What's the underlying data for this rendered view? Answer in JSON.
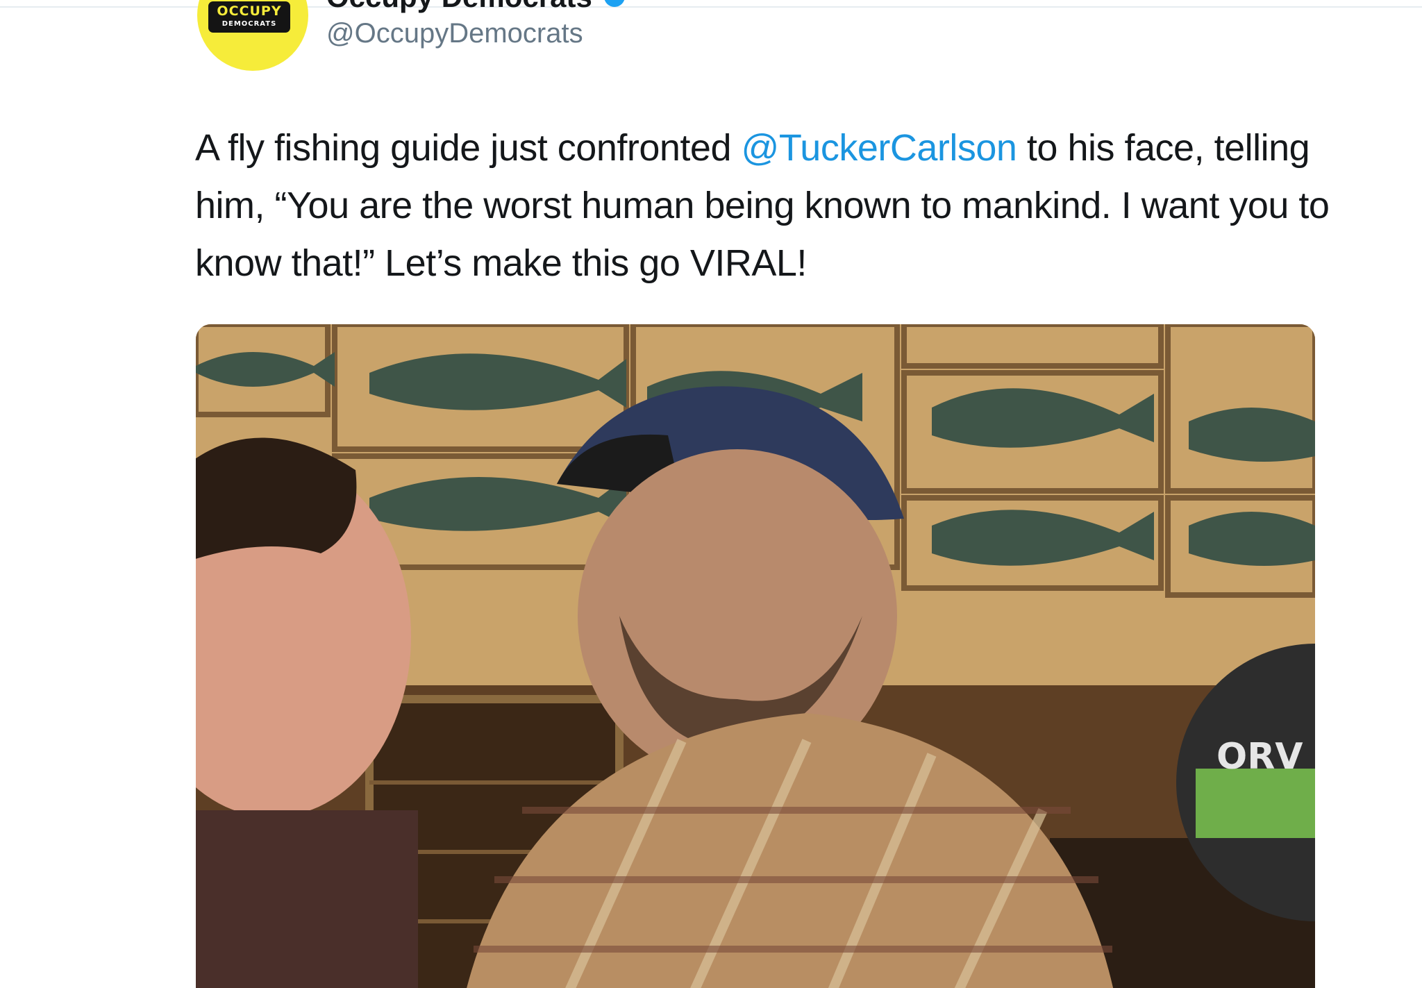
{
  "tweet": {
    "avatar_label_top": "OCCUPY",
    "avatar_label_bottom": "DEMOCRATS",
    "display_name": "Occupy Democrats",
    "handle": "@OccupyDemocrats",
    "text_before": "A fly fishing guide just confronted ",
    "mention": "@TuckerCarlson",
    "text_after": " to his face, telling him, “You are the worst human being known to mankind. I want you to know that!” Let’s make this go VIRAL!"
  },
  "media": {
    "sign_text": "ORV"
  },
  "colors": {
    "mention": "#1b95e0",
    "text": "#14171a",
    "handle": "#657786",
    "avatar_bg": "#f6ec3a"
  }
}
